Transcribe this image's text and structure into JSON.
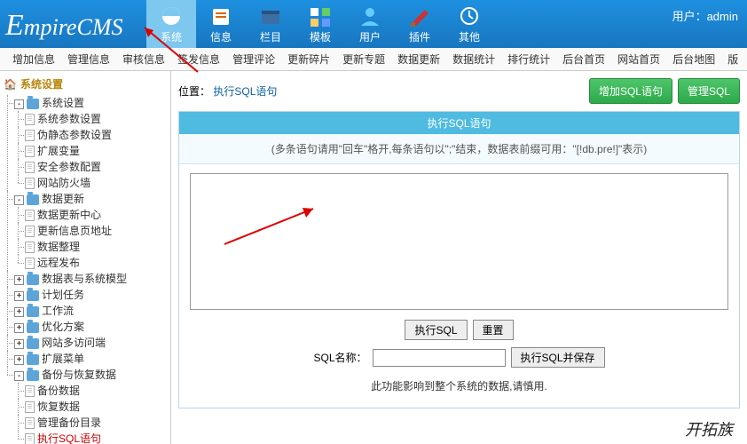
{
  "top": {
    "logo": "mpireCMS",
    "menu": [
      {
        "id": "system",
        "label": "系统",
        "active": true
      },
      {
        "id": "info",
        "label": "信息"
      },
      {
        "id": "column",
        "label": "栏目"
      },
      {
        "id": "template",
        "label": "模板"
      },
      {
        "id": "user",
        "label": "用户"
      },
      {
        "id": "plugin",
        "label": "插件"
      },
      {
        "id": "other",
        "label": "其他"
      }
    ],
    "user_prefix": "用户：",
    "user_name": "admin"
  },
  "sub": [
    "增加信息",
    "管理信息",
    "审核信息",
    "签发信息",
    "管理评论",
    "更新碎片",
    "更新专题",
    "数据更新",
    "数据统计",
    "排行统计",
    "后台首页",
    "网站首页",
    "后台地图",
    "版"
  ],
  "sidebar": {
    "title": "系统设置",
    "tree": [
      {
        "type": "folder",
        "exp": "-",
        "label": "系统设置",
        "children": [
          {
            "type": "file",
            "label": "系统参数设置"
          },
          {
            "type": "file",
            "label": "伪静态参数设置"
          },
          {
            "type": "file",
            "label": "扩展变量"
          },
          {
            "type": "file",
            "label": "安全参数配置"
          },
          {
            "type": "file",
            "label": "网站防火墙"
          }
        ]
      },
      {
        "type": "folder",
        "exp": "-",
        "label": "数据更新",
        "children": [
          {
            "type": "file",
            "label": "数据更新中心"
          },
          {
            "type": "file",
            "label": "更新信息页地址"
          },
          {
            "type": "file",
            "label": "数据整理"
          },
          {
            "type": "file",
            "label": "远程发布"
          }
        ]
      },
      {
        "type": "folder",
        "exp": "+",
        "label": "数据表与系统模型"
      },
      {
        "type": "folder",
        "exp": "+",
        "label": "计划任务"
      },
      {
        "type": "folder",
        "exp": "+",
        "label": "工作流"
      },
      {
        "type": "folder",
        "exp": "+",
        "label": "优化方案"
      },
      {
        "type": "folder",
        "exp": "+",
        "label": "网站多访问端"
      },
      {
        "type": "folder",
        "exp": "+",
        "label": "扩展菜单"
      },
      {
        "type": "folder",
        "exp": "-",
        "label": "备份与恢复数据",
        "children": [
          {
            "type": "file",
            "label": "备份数据"
          },
          {
            "type": "file",
            "label": "恢复数据"
          },
          {
            "type": "file",
            "label": "管理备份目录"
          },
          {
            "type": "file",
            "label": "执行SQL语句",
            "hot": true
          }
        ]
      }
    ]
  },
  "main": {
    "crumb_prefix": "位置：",
    "crumb": "执行SQL语句",
    "btn_add": "增加SQL语句",
    "btn_manage": "管理SQL",
    "panel_title": "执行SQL语句",
    "hint": "(多条语句请用\"回车\"格开,每条语句以\";\"结束，数据表前缀可用：\"[!db.pre!]\"表示)",
    "btn_run": "执行SQL",
    "btn_reset": "重置",
    "name_label": "SQL名称：",
    "btn_save": "执行SQL并保存",
    "note": "此功能影响到整个系统的数据,请慎用."
  },
  "watermark": "开拓族"
}
